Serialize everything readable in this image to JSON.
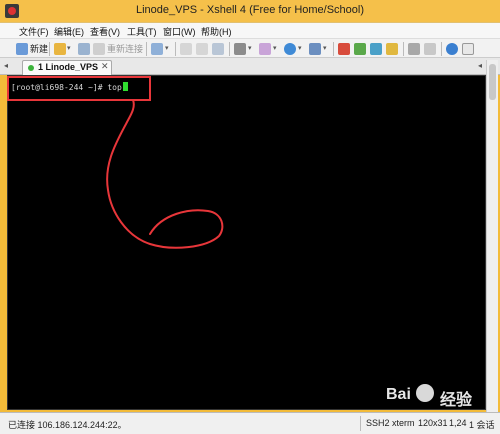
{
  "window": {
    "title": "Linode_VPS - Xshell 4 (Free for Home/School)"
  },
  "menu": [
    "文件(F)",
    "编辑(E)",
    "查看(V)",
    "工具(T)",
    "窗口(W)",
    "帮助(H)"
  ],
  "toolbar": {
    "new_label": "新建",
    "reconnect_label": "重新连接"
  },
  "tabs": [
    {
      "label": "1 Linode_VPS"
    }
  ],
  "terminal": {
    "prompt": "[root@li698-244 ~]# ",
    "command": "top"
  },
  "status": {
    "connection": "已连接 106.186.124.244:22。",
    "protocol": "SSH2",
    "term_type": "xterm",
    "size": "120x31",
    "cursor_pos": "1,24",
    "sessions": "1 会话"
  },
  "watermark": {
    "brand": "Bai",
    "suffix": "经验"
  },
  "colors": {
    "title_bar": "#f5c04a",
    "terminal_bg": "#000000",
    "cursor": "#2fdc2f",
    "annotation": "#e8363a"
  }
}
